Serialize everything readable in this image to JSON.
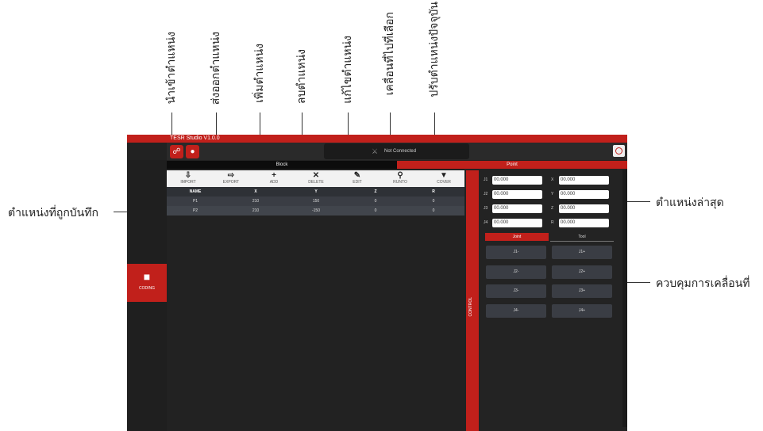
{
  "annotations": {
    "import": "นำเข้าตำแหน่ง",
    "export": "ส่งออกตำแหน่ง",
    "add": "เพิ่มตำแหน่ง",
    "delete": "ลบตำแหน่ง",
    "edit": "แก้ไขตำแหน่ง",
    "runto": "เคลื่อนที่ไปที่เลือก",
    "cover": "ปรับตำแหน่งปัจจุบัน",
    "saved_positions": "ตำแหน่งที่ถูกบันทึก",
    "latest_position": "ตำแหน่งล่าสุด",
    "motion_control": "ควบคุมการเคลื่อนที่"
  },
  "app": {
    "title": "TESR Studio V1.0.0",
    "status": "Not Connected",
    "block_header": "Block",
    "point_header": "Point",
    "coding_label": "CODING",
    "control_label": "CONTROL"
  },
  "actions": [
    "IMPORT",
    "EXPORT",
    "ADD",
    "DELETE",
    "EDIT",
    "RUNTO",
    "COVER"
  ],
  "table": {
    "headers": [
      "NAME",
      "X",
      "Y",
      "Z",
      "R"
    ],
    "rows": [
      [
        "P1",
        "210",
        "150",
        "0",
        "0"
      ],
      [
        "P2",
        "210",
        "-150",
        "0",
        "0"
      ]
    ]
  },
  "position": {
    "labels": [
      "J1",
      "J2",
      "J3",
      "J4",
      "X",
      "Y",
      "Z",
      "R"
    ],
    "j1": "00.000",
    "j2": "00.000",
    "j3": "00.000",
    "j4": "00.000",
    "x": "00.000",
    "y": "00.000",
    "z": "00.000",
    "r": "00.000"
  },
  "control": {
    "tab_joint": "Joint",
    "tab_tool": "Tool",
    "buttons": [
      "J1-",
      "J1+",
      "J2-",
      "J2+",
      "J3-",
      "J3+",
      "J4-",
      "J4+"
    ]
  }
}
